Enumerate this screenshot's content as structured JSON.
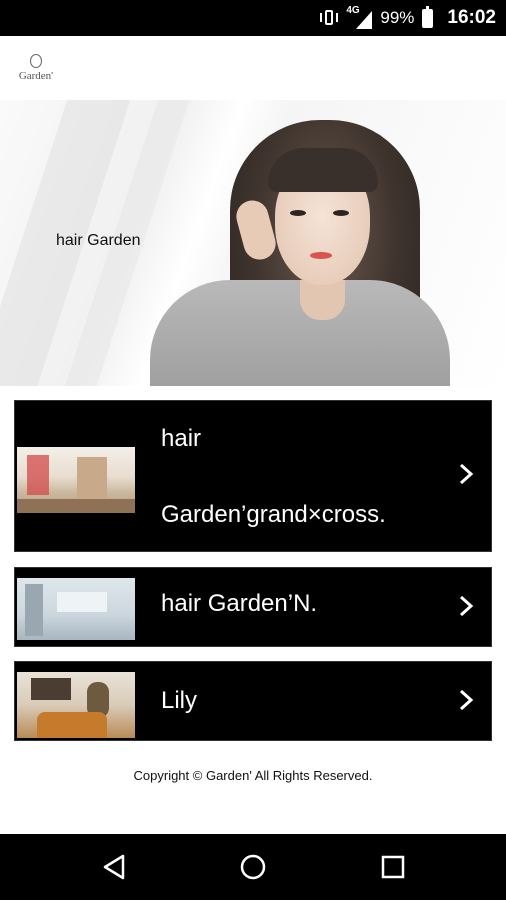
{
  "status_bar": {
    "network": "4G",
    "battery": "99%",
    "time": "16:02",
    "icons": [
      "vibrate-icon",
      "signal-icon",
      "battery-icon"
    ]
  },
  "header": {
    "logo_text": "Garden'"
  },
  "hero": {
    "caption": "hair Garden",
    "slide_count": 2,
    "active_slide": 1
  },
  "salons": [
    {
      "label_line1": "hair",
      "label_line2": "Garden’grand×cross."
    },
    {
      "label": "hair Garden’N."
    },
    {
      "label": "Lily"
    }
  ],
  "footer": {
    "copyright": "Copyright © Garden' All Rights Reserved."
  },
  "nav_bar": {
    "icons": [
      "back-icon",
      "home-icon",
      "recents-icon"
    ]
  },
  "colors": {
    "card_bg": "#000000",
    "text_on_card": "#ffffff",
    "page_bg": "#ffffff"
  }
}
